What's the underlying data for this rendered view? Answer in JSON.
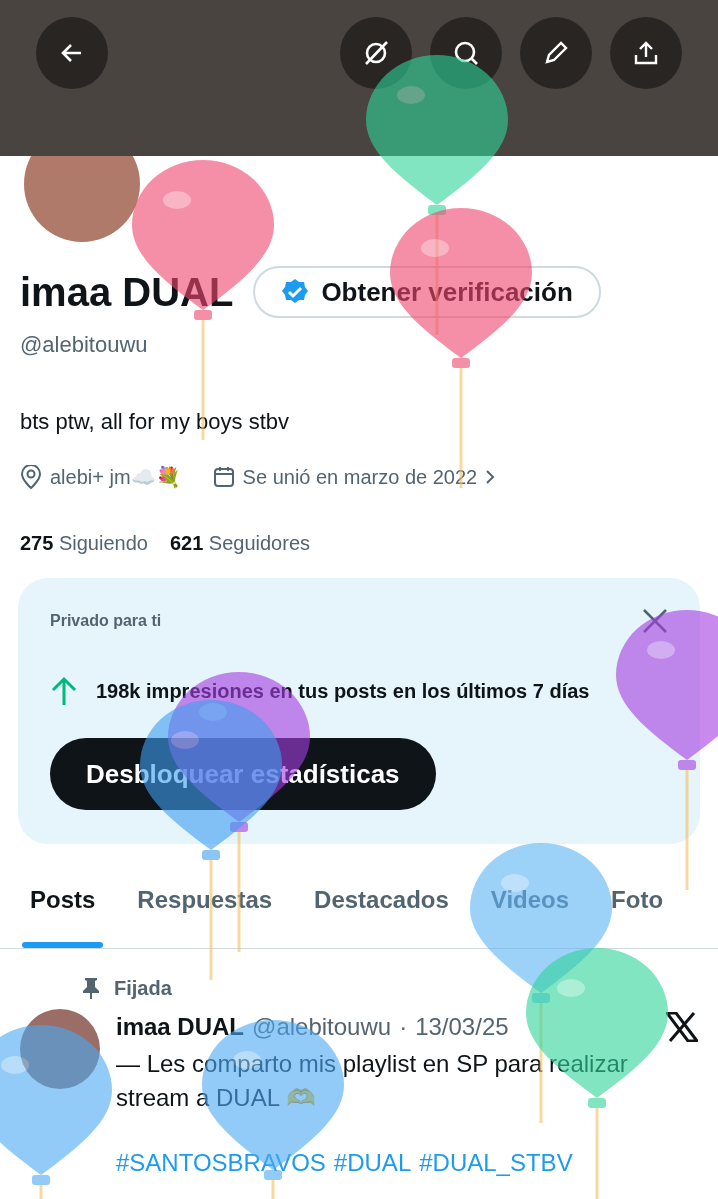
{
  "header": {
    "buttons": [
      {
        "kind": "back"
      },
      {
        "kind": "grok"
      },
      {
        "kind": "search"
      },
      {
        "kind": "edit"
      },
      {
        "kind": "share"
      }
    ]
  },
  "profile": {
    "name": "imaa DUAL",
    "verify_button": "Obtener verificación",
    "handle": "@alebitouwu",
    "bio": "bts ptw, all for my boys stbv",
    "location": "alebi+ jm☁️💐",
    "joined": "Se unió en marzo de 2022",
    "stats": [
      {
        "count": "275",
        "label": "Siguiendo"
      },
      {
        "count": "621",
        "label": "Seguidores"
      }
    ]
  },
  "insights_card": {
    "title": "Privado para ti",
    "message": "198k impresiones en tus posts en los últimos 7 días",
    "button": "Desbloquear estadísticas"
  },
  "tabs": [
    {
      "label": "Posts",
      "selected": true
    },
    {
      "label": "Respuestas",
      "selected": false
    },
    {
      "label": "Destacados",
      "selected": false
    },
    {
      "label": "Videos",
      "selected": false
    },
    {
      "label": "Foto",
      "selected": false
    }
  ],
  "pinned_post": {
    "pinned_label": "Fijada",
    "author": "imaa DUAL",
    "handle": "@alebitouwu",
    "separator": "·",
    "date": "13/03/25",
    "text": "— Les comparto mis playlist en SP para realizar stream a DUAL 🫶",
    "hashtags": [
      "#SANTOSBRAVOS",
      "#DUAL",
      "#DUAL_STBV"
    ]
  }
}
